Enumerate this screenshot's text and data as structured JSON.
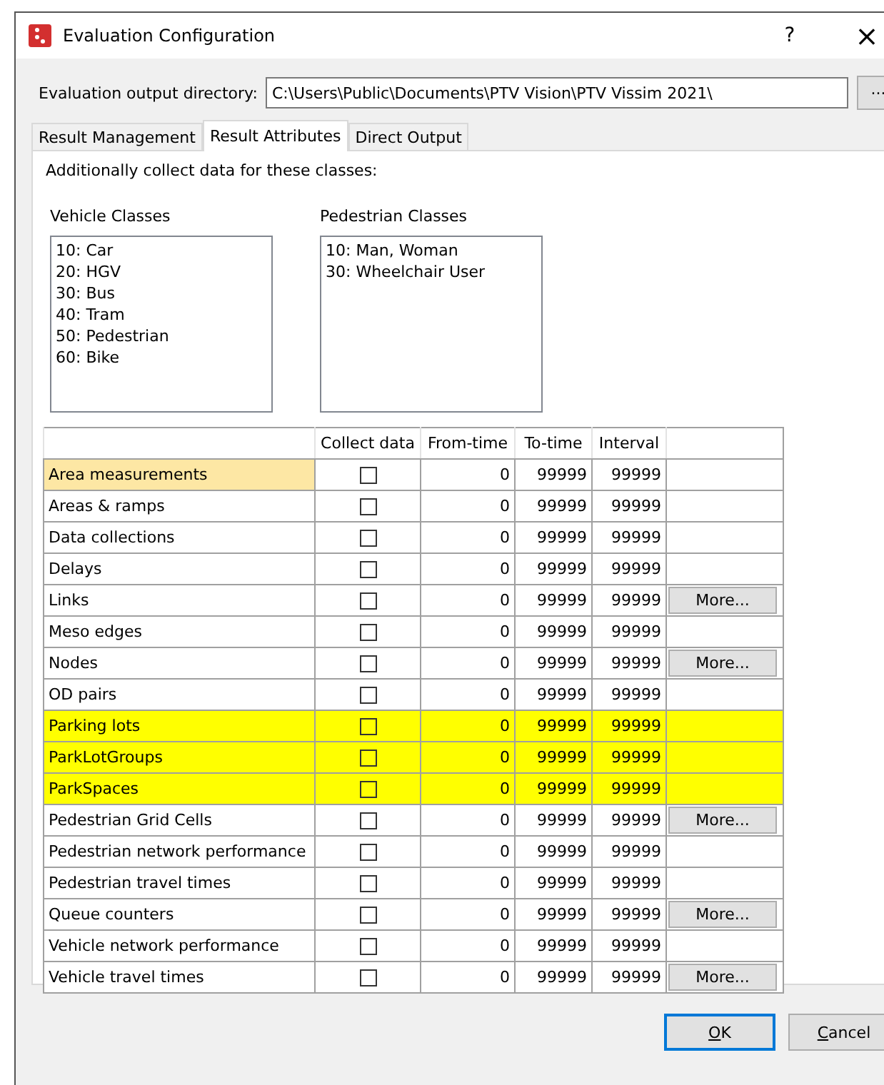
{
  "window": {
    "title": "Evaluation Configuration",
    "help": "?",
    "close": "×"
  },
  "output_directory": {
    "label": "Evaluation output directory:",
    "value": "C:\\Users\\Public\\Documents\\PTV Vision\\PTV Vissim 2021\\",
    "browse": "..."
  },
  "tabs": [
    {
      "label": "Result Management",
      "selected": false
    },
    {
      "label": "Result Attributes",
      "selected": true
    },
    {
      "label": "Direct Output",
      "selected": false
    }
  ],
  "intro": "Additionally collect data for these classes:",
  "vehicle_classes": {
    "label": "Vehicle Classes",
    "items": [
      "10: Car",
      "20: HGV",
      "30: Bus",
      "40: Tram",
      "50: Pedestrian",
      "60: Bike"
    ]
  },
  "pedestrian_classes": {
    "label": "Pedestrian Classes",
    "items": [
      "10: Man, Woman",
      "30: Wheelchair User"
    ]
  },
  "table": {
    "columns": [
      "Collect data",
      "From-time",
      "To-time",
      "Interval"
    ],
    "rows": [
      {
        "name": "Area measurements",
        "collect": false,
        "from": "0",
        "to": "99999",
        "interval": "99999",
        "selected": true,
        "highlighted": false
      },
      {
        "name": "Areas & ramps",
        "collect": false,
        "from": "0",
        "to": "99999",
        "interval": "99999",
        "selected": false,
        "highlighted": false
      },
      {
        "name": "Data collections",
        "collect": false,
        "from": "0",
        "to": "99999",
        "interval": "99999",
        "selected": false,
        "highlighted": false
      },
      {
        "name": "Delays",
        "collect": false,
        "from": "0",
        "to": "99999",
        "interval": "99999",
        "selected": false,
        "highlighted": false
      },
      {
        "name": "Links",
        "collect": false,
        "from": "0",
        "to": "99999",
        "interval": "99999",
        "selected": false,
        "highlighted": false,
        "more": "More..."
      },
      {
        "name": "Meso edges",
        "collect": false,
        "from": "0",
        "to": "99999",
        "interval": "99999",
        "selected": false,
        "highlighted": false
      },
      {
        "name": "Nodes",
        "collect": false,
        "from": "0",
        "to": "99999",
        "interval": "99999",
        "selected": false,
        "highlighted": false,
        "more": "More..."
      },
      {
        "name": "OD pairs",
        "collect": false,
        "from": "0",
        "to": "99999",
        "interval": "99999",
        "selected": false,
        "highlighted": false
      },
      {
        "name": "Parking lots",
        "collect": false,
        "from": "0",
        "to": "99999",
        "interval": "99999",
        "selected": false,
        "highlighted": true
      },
      {
        "name": "ParkLotGroups",
        "collect": false,
        "from": "0",
        "to": "99999",
        "interval": "99999",
        "selected": false,
        "highlighted": true
      },
      {
        "name": "ParkSpaces",
        "collect": false,
        "from": "0",
        "to": "99999",
        "interval": "99999",
        "selected": false,
        "highlighted": true
      },
      {
        "name": "Pedestrian Grid Cells",
        "collect": false,
        "from": "0",
        "to": "99999",
        "interval": "99999",
        "selected": false,
        "highlighted": false,
        "more": "More..."
      },
      {
        "name": "Pedestrian network performance",
        "collect": false,
        "from": "0",
        "to": "99999",
        "interval": "99999",
        "selected": false,
        "highlighted": false
      },
      {
        "name": "Pedestrian travel times",
        "collect": false,
        "from": "0",
        "to": "99999",
        "interval": "99999",
        "selected": false,
        "highlighted": false
      },
      {
        "name": "Queue counters",
        "collect": false,
        "from": "0",
        "to": "99999",
        "interval": "99999",
        "selected": false,
        "highlighted": false,
        "more": "More..."
      },
      {
        "name": "Vehicle network performance",
        "collect": false,
        "from": "0",
        "to": "99999",
        "interval": "99999",
        "selected": false,
        "highlighted": false
      },
      {
        "name": "Vehicle travel times",
        "collect": false,
        "from": "0",
        "to": "99999",
        "interval": "99999",
        "selected": false,
        "highlighted": false,
        "more": "More..."
      }
    ]
  },
  "buttons": [
    {
      "label": "OK",
      "default": true
    },
    {
      "label": "Cancel",
      "default": false
    }
  ]
}
